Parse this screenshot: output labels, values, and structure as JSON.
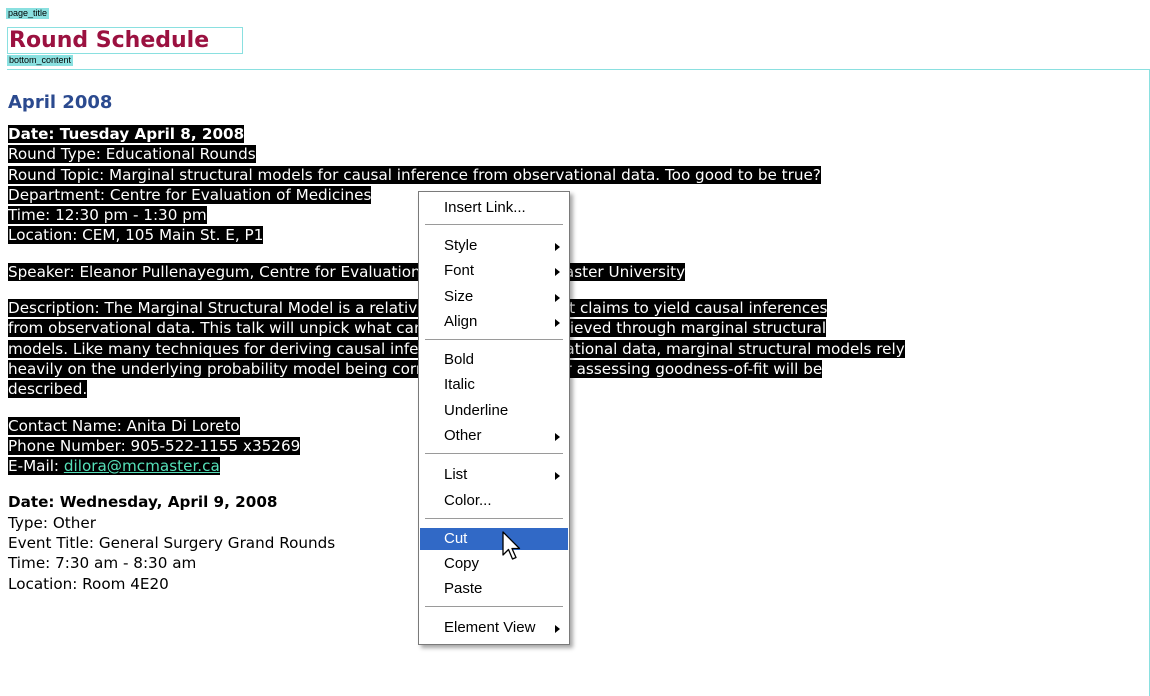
{
  "tags": {
    "page_title": "page_title",
    "bottom_content": "bottom_content"
  },
  "page": {
    "title": "Round Schedule",
    "month": "April 2008"
  },
  "event1": {
    "date": "Date: Tuesday April 8, 2008",
    "round_type": "Round Type: Educational Rounds",
    "round_topic": "Round Topic: Marginal structural models for causal inference from observational data. Too good to be true?",
    "department": "Department: Centre for Evaluation of Medicines",
    "time": "Time: 12:30 pm - 1:30 pm",
    "location": "Location: CEM, 105 Main St. E, P1",
    "speaker": "Speaker: Eleanor Pullenayegum, Centre for Evaluation of Medicines, McMaster University",
    "description": [
      "Description: The Marginal Structural Model is a relatively new method that claims to yield causal inferences",
      "from observational data. This talk will unpick what can and cannot be achieved through marginal structural",
      "models. Like many techniques for deriving causal inferences from observational data, marginal structural models rely",
      "heavily on the underlying probability model being correct. A technique for assessing goodness-of-fit will be",
      "described."
    ],
    "contact_name": "Contact Name: Anita Di Loreto",
    "phone": "Phone Number: 905-522-1155 x35269",
    "email_label": "E-Mail: ",
    "email": "dilora@mcmaster.ca"
  },
  "event2": {
    "date": "Date: Wednesday, April 9, 2008",
    "type": "Type: Other",
    "event_title": "Event Title: General Surgery Grand Rounds",
    "time": "Time: 7:30 am - 8:30 am",
    "location": "Location: Room 4E20"
  },
  "context_menu": {
    "items": [
      {
        "label": "Insert Link...",
        "submenu": false
      },
      {
        "label": "Style",
        "submenu": true
      },
      {
        "label": "Font",
        "submenu": true
      },
      {
        "label": "Size",
        "submenu": true
      },
      {
        "label": "Align",
        "submenu": true
      },
      {
        "label": "Bold",
        "submenu": false
      },
      {
        "label": "Italic",
        "submenu": false
      },
      {
        "label": "Underline",
        "submenu": false
      },
      {
        "label": "Other",
        "submenu": true
      },
      {
        "label": "List",
        "submenu": true
      },
      {
        "label": "Color...",
        "submenu": false
      },
      {
        "label": "Cut",
        "submenu": false,
        "highlighted": true
      },
      {
        "label": "Copy",
        "submenu": false
      },
      {
        "label": "Paste",
        "submenu": false
      },
      {
        "label": "Element View",
        "submenu": true
      }
    ]
  },
  "colors": {
    "title": "#9b1140",
    "month": "#2b4a8f",
    "highlight": "#3169c6",
    "region_outline": "#8ae0e0"
  }
}
